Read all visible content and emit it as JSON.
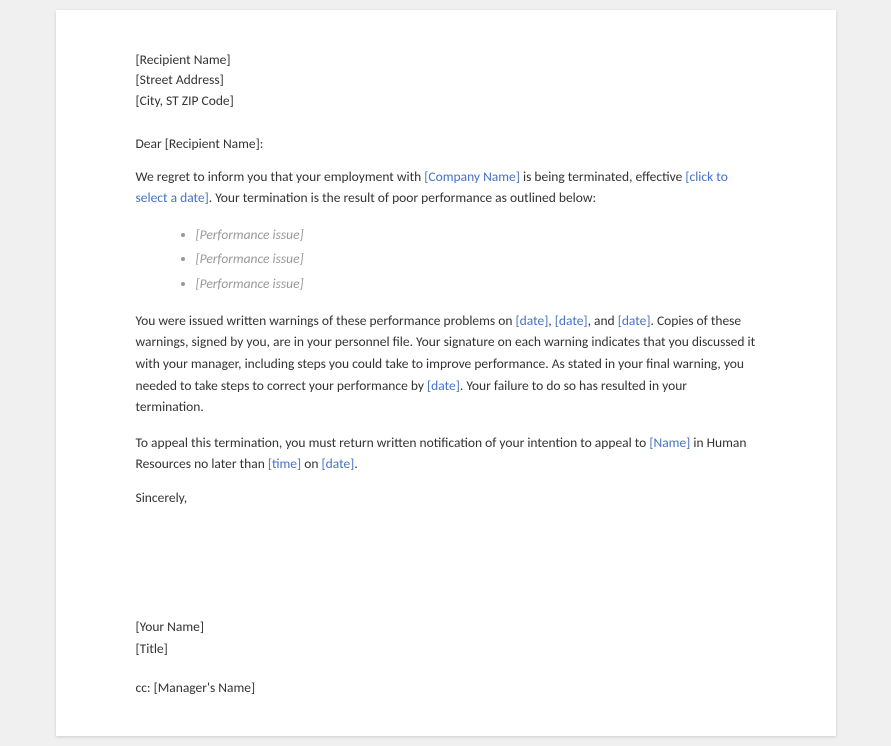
{
  "document": {
    "address": {
      "recipient": "[Recipient Name]",
      "street": "[Street Address]",
      "city": "[City, ST ZIP Code]"
    },
    "salutation": {
      "text": "Dear [Recipient Name]:"
    },
    "paragraph1": {
      "before_company": "We regret to inform you that your employment with ",
      "company": "[Company Name]",
      "between": " is being terminated, effective ",
      "date_link": "[click to select a date]",
      "after": ". Your termination is the result of poor performance as outlined below:"
    },
    "bullets": [
      "[Performance issue]",
      "[Performance issue]",
      "[Performance issue]"
    ],
    "paragraph2": {
      "before_dates": "You were issued written warnings of these performance problems on ",
      "date1": "[date]",
      "comma1": ", ",
      "date2": "[date]",
      "and": ", and ",
      "date3": "[date]",
      "after1": ". Copies of these warnings, signed by you, are in your personnel file. Your signature on each warning indicates that you discussed it with your manager, including steps you could take to improve performance. As stated in your final warning, you needed to take steps to correct your performance by ",
      "date4": "[date]",
      "after2": ". Your failure to do so has resulted in your termination."
    },
    "paragraph3": {
      "before_name": "To appeal this termination, you must return written notification of your intention to appeal to ",
      "name": "[Name]",
      "middle": " in Human Resources no later than ",
      "time": "[time]",
      "on": " on ",
      "date": "[date]",
      "end": "."
    },
    "sincerely": "Sincerely,",
    "signature": {
      "name": "[Your Name]",
      "title": "[Title]"
    },
    "cc": {
      "label": "cc: ",
      "name": "[Manager's Name]"
    }
  }
}
